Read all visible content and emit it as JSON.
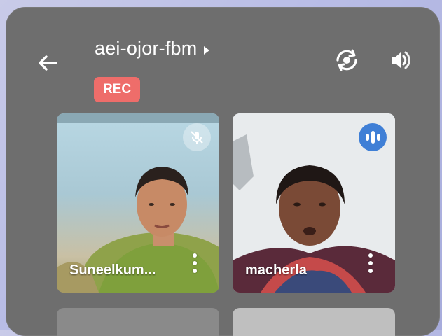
{
  "meeting": {
    "title": "aei-ojor-fbm",
    "rec_label": "REC"
  },
  "participants": [
    {
      "name": "Suneelkum...",
      "status": "muted"
    },
    {
      "name": "macherla",
      "status": "speaking"
    }
  ],
  "icons": {
    "back": "arrow-left-icon",
    "switch_camera": "camera-switch-icon",
    "audio": "speaker-icon",
    "title_more": "caret-right-icon",
    "muted": "mic-off-icon",
    "speaking": "audio-bars-icon",
    "more": "more-vert-icon"
  },
  "colors": {
    "panel": "#6e6e6e",
    "rec": "#ee6d6a",
    "speaking": "#3f7fd6"
  }
}
